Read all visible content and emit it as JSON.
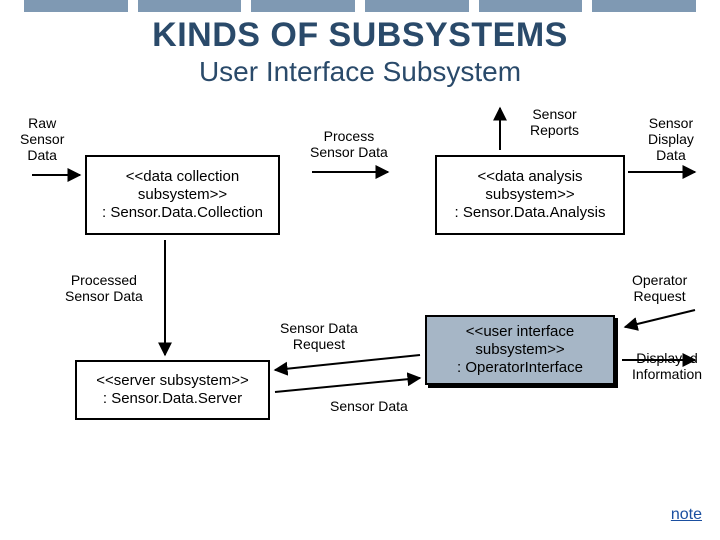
{
  "header": {
    "title": "KINDS OF SUBSYSTEMS",
    "subtitle": "User Interface Subsystem"
  },
  "nodes": {
    "collection": {
      "stereotype": "<<data collection subsystem>>",
      "name": ": Sensor.Data.Collection"
    },
    "analysis": {
      "stereotype": "<<data analysis subsystem>>",
      "name": ": Sensor.Data.Analysis"
    },
    "server": {
      "stereotype": "<<server subsystem>>",
      "name": ": Sensor.Data.Server"
    },
    "ui": {
      "stereotype": "<<user interface subsystem>>",
      "name": ": OperatorInterface"
    }
  },
  "flows": {
    "raw": "Raw\nSensor\nData",
    "process": "Process\nSensor Data",
    "reports": "Sensor\nReports",
    "display": "Sensor\nDisplay\nData",
    "processed": "Processed\nSensor Data",
    "request": "Sensor Data\nRequest",
    "data": "Sensor Data",
    "opreq": "Operator\nRequest",
    "displayed": "Displayed\nInformation"
  },
  "note": "note"
}
